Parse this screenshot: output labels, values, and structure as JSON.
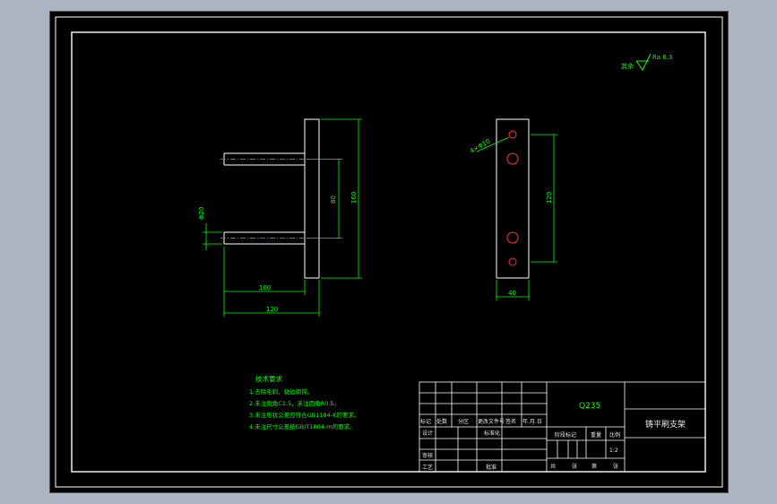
{
  "drawing": {
    "title": "铸平刷支架",
    "material": "Q235",
    "scale": "1:2",
    "roughness": {
      "label": "其余",
      "value": "Ra 6.3"
    }
  },
  "tech_requirements": {
    "heading": "技术要求",
    "items": [
      "1.去除毛刺、锐边倒钝。",
      "2.未注倒角C1.5，未注圆角R0.5。",
      "3.未注形状公差应符合GB1184-K的要求。",
      "4.未注尺寸公差按GB/T1804-m的要求。"
    ]
  },
  "dimensions": {
    "d1": "100",
    "d2": "120",
    "d3": "80",
    "d4": "160",
    "d5": "Φ20",
    "d6": "4×Φ10",
    "d7": "120",
    "d8": "40"
  },
  "title_block": {
    "row_labels": [
      "标记",
      "处数",
      "分区",
      "更改文件号",
      "签名",
      "年.月.日"
    ],
    "design": "设计",
    "standardize": "标准化",
    "review": "审核",
    "process": "工艺",
    "approve": "批准",
    "stage_mark": "阶段标记",
    "weight": "重量",
    "scale_label": "比例",
    "sheet_total": "共",
    "sheet_label": "张",
    "sheet_no": "第",
    "sheet_label2": "张"
  },
  "colors": {
    "outline": "#ffffff",
    "dimension": "#00ff00",
    "centerline": "#ff3333",
    "hole": "#ff3333",
    "background": "#000000"
  }
}
